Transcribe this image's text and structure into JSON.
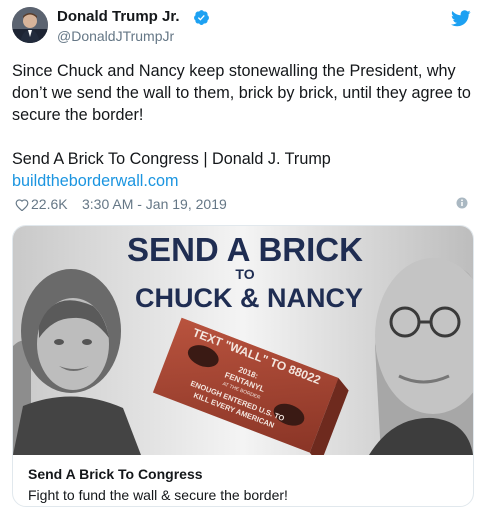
{
  "header": {
    "name": "Donald Trump Jr.",
    "handle": "@DonaldJTrumpJr",
    "avatar_icon": "avatar-photo",
    "verified_icon": "verified-badge-icon",
    "brand_icon": "twitter-bird-icon"
  },
  "tweet": {
    "text": "Since Chuck and Nancy keep stonewalling the President, why don’t we send the wall to them, brick by brick, until they agree to secure the border!",
    "link_title": "Send A Brick To Congress | Donald J. Trump",
    "link_url": "buildtheborderwall.com"
  },
  "meta": {
    "likes": "22.6K",
    "timestamp": "3:30 AM - Jan 19, 2019",
    "heart_icon": "heart-icon",
    "info_icon": "info-icon"
  },
  "card": {
    "image": {
      "headline_line1": "SEND A BRICK",
      "headline_to": "TO",
      "headline_line2": "CHUCK & NANCY",
      "brick_text_1": "TEXT \"WALL\" TO 88022",
      "brick_text_2": "2018:",
      "brick_text_3": "FENTANYL",
      "brick_text_4": "AT THE BORDER",
      "brick_text_5": "ENOUGH ENTERED U.S. TO",
      "brick_text_6": "KILL EVERY AMERICAN"
    },
    "title": "Send A Brick To Congress",
    "description": "Fight to fund the wall & secure the border!"
  },
  "colors": {
    "link": "#1b95e0",
    "secondary_text": "#657786",
    "headline_navy": "#1f2d52",
    "brick_red": "#a0412f",
    "verified_blue": "#1da1f2"
  }
}
